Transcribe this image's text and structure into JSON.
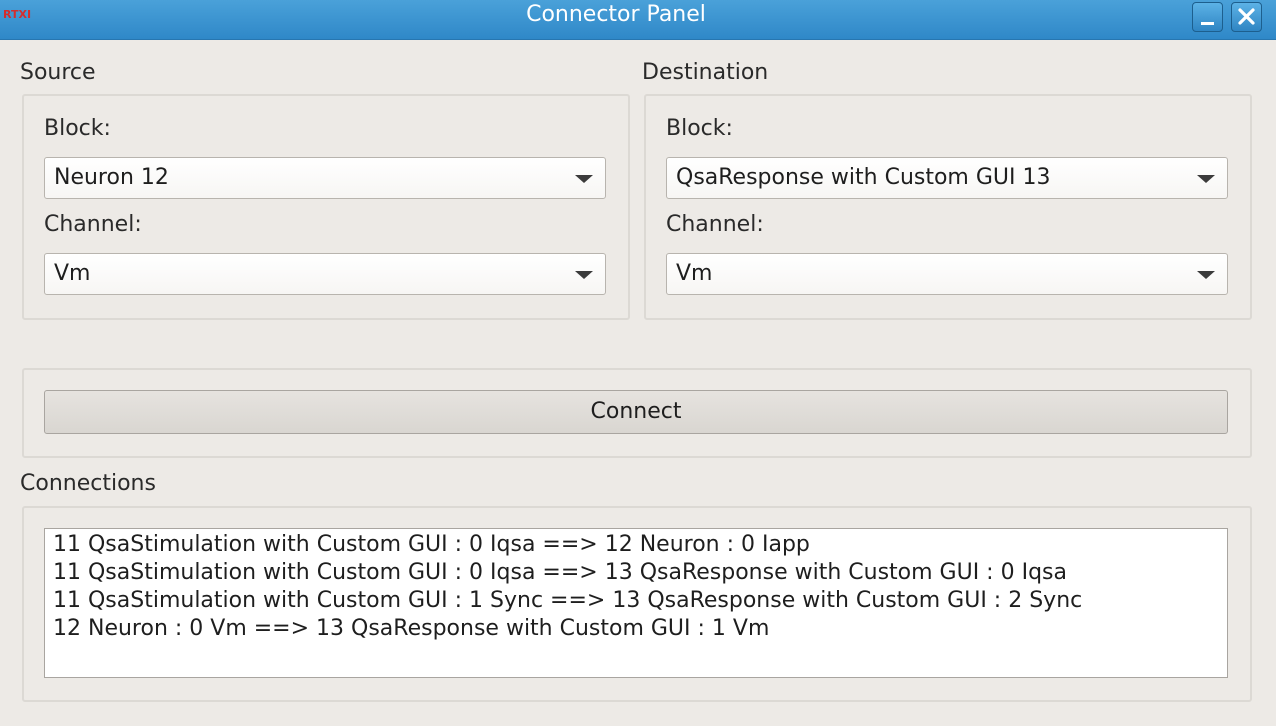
{
  "titlebar": {
    "app_logo": "RTXI",
    "title": "Connector Panel",
    "minimize_icon": "minimize-icon",
    "close_icon": "close-icon"
  },
  "source": {
    "label": "Source",
    "block_label": "Block:",
    "block_value": "Neuron 12",
    "channel_label": "Channel:",
    "channel_value": "Vm"
  },
  "destination": {
    "label": "Destination",
    "block_label": "Block:",
    "block_value": "QsaResponse with Custom GUI 13",
    "channel_label": "Channel:",
    "channel_value": "Vm"
  },
  "connect_button": "Connect",
  "connections": {
    "label": "Connections",
    "items": [
      "11 QsaStimulation with Custom GUI : 0 Iqsa ==> 12 Neuron : 0 Iapp",
      "11 QsaStimulation with Custom GUI : 0 Iqsa ==> 13 QsaResponse with Custom GUI : 0 Iqsa",
      "11 QsaStimulation with Custom GUI : 1 Sync ==> 13 QsaResponse with Custom GUI : 2 Sync",
      "12 Neuron : 0 Vm ==> 13 QsaResponse with Custom GUI : 1 Vm"
    ]
  },
  "colors": {
    "titlebar": "#2f88c8",
    "window_bg": "#edeae6",
    "logo": "#d42d2d"
  }
}
